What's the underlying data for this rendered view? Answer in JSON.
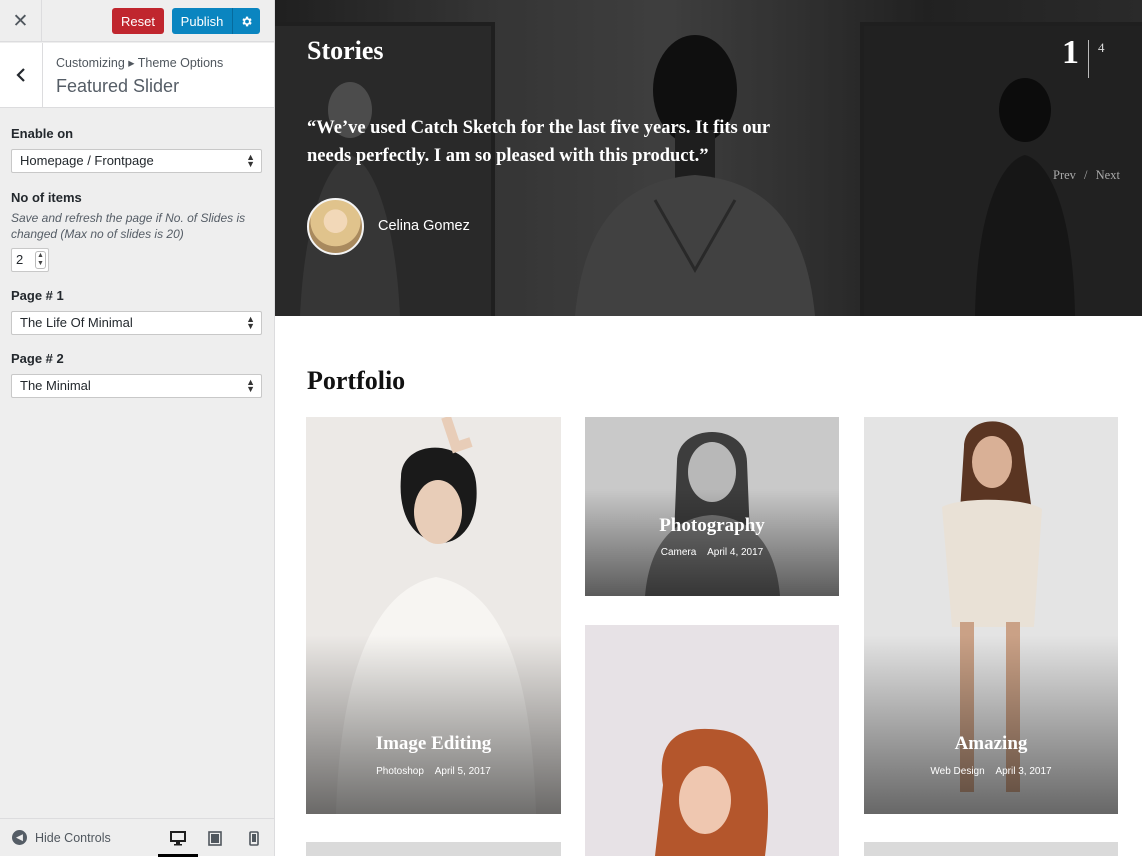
{
  "toolbar": {
    "close_glyph": "✕",
    "reset_label": "Reset",
    "publish_label": "Publish"
  },
  "section": {
    "breadcrumb": "Customizing ▸ Theme Options",
    "title": "Featured Slider"
  },
  "controls": {
    "enable_on": {
      "label": "Enable on",
      "value": "Homepage / Frontpage"
    },
    "items": {
      "label": "No of items",
      "description": "Save and refresh the page if No. of Slides is changed (Max no of slides is 20)",
      "value": "2"
    },
    "page1": {
      "label": "Page # 1",
      "value": "The Life Of Minimal"
    },
    "page2": {
      "label": "Page # 2",
      "value": "The Minimal"
    }
  },
  "footer": {
    "hide_controls": "Hide Controls",
    "devices": [
      "desktop-icon",
      "tablet-icon",
      "mobile-icon"
    ]
  },
  "hero": {
    "heading": "Stories",
    "quote": "“We’ve used Catch Sketch for the last five years. It fits our needs perfectly. I am so pleased with this product.”",
    "author": "Celina Gomez",
    "current_slide": "1",
    "total_slides": "4",
    "prev": "Prev",
    "separator": "/",
    "next": "Next"
  },
  "portfolio": {
    "heading": "Portfolio",
    "items": [
      {
        "title": "Image Editing",
        "category": "Photoshop",
        "date": "April 5, 2017"
      },
      {
        "title": "Photography",
        "category": "Camera",
        "date": "April 4, 2017"
      },
      {
        "title": "Amazing",
        "category": "Web Design",
        "date": "April 3, 2017"
      }
    ]
  },
  "colors": {
    "reset": "#c0262e",
    "publish": "#0a85c0",
    "sidebar_bg": "#eeeeee"
  }
}
